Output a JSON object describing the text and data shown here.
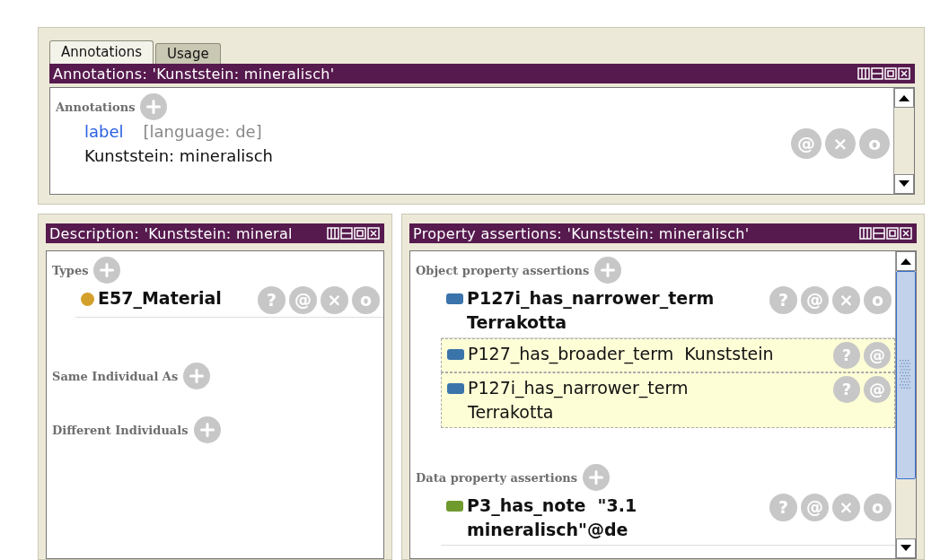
{
  "tabs": [
    {
      "label": "Annotations",
      "selected": true
    },
    {
      "label": "Usage",
      "selected": false
    }
  ],
  "annotations_view": {
    "title": "Annotations: 'Kunststein: mineralisch'",
    "sections": [
      {
        "header": "Annotations",
        "items": [
          {
            "property": "label",
            "language": "[language: de]",
            "value": "Kunststein: mineralisch",
            "actions": [
              "@",
              "×",
              "o"
            ]
          }
        ]
      }
    ]
  },
  "description_view": {
    "title": "Description: 'Kunststein: mineral",
    "sections": [
      {
        "header": "Types",
        "items": [
          {
            "lines": [
              "E57_Material"
            ],
            "kind": "class",
            "color": "#d4a02c",
            "inferred": false,
            "actions": [
              "?",
              "@",
              "×",
              "o"
            ]
          }
        ]
      },
      {
        "header": "Same Individual As"
      },
      {
        "header": "Different Individuals"
      }
    ]
  },
  "property_view": {
    "title": "Property assertions: 'Kunststein: mineralisch'",
    "sections": [
      {
        "header": "Object property assertions",
        "items": [
          {
            "lines": [
              "P127i_has_narrower_term",
              "Terrakotta"
            ],
            "kind": "property",
            "color": "#3a74aa",
            "inferred": false,
            "actions": [
              "?",
              "@",
              "×",
              "o"
            ]
          },
          {
            "lines": [
              "P127_has_broader_term  Kunststein"
            ],
            "kind": "property",
            "color": "#3a74aa",
            "inferred": true,
            "actions": [
              "?",
              "@"
            ]
          },
          {
            "lines": [
              "P127i_has_narrower_term",
              "Terrakotta"
            ],
            "kind": "property",
            "color": "#3a74aa",
            "inferred": true,
            "actions": [
              "?",
              "@"
            ]
          }
        ]
      },
      {
        "header": "Data property assertions",
        "items": [
          {
            "lines": [
              "P3_has_note  \"3.1",
              "mineralisch\"@de"
            ],
            "kind": "property",
            "color": "#6f9a2e",
            "inferred": false,
            "actions": [
              "?",
              "@",
              "×",
              "o"
            ]
          }
        ]
      }
    ]
  }
}
